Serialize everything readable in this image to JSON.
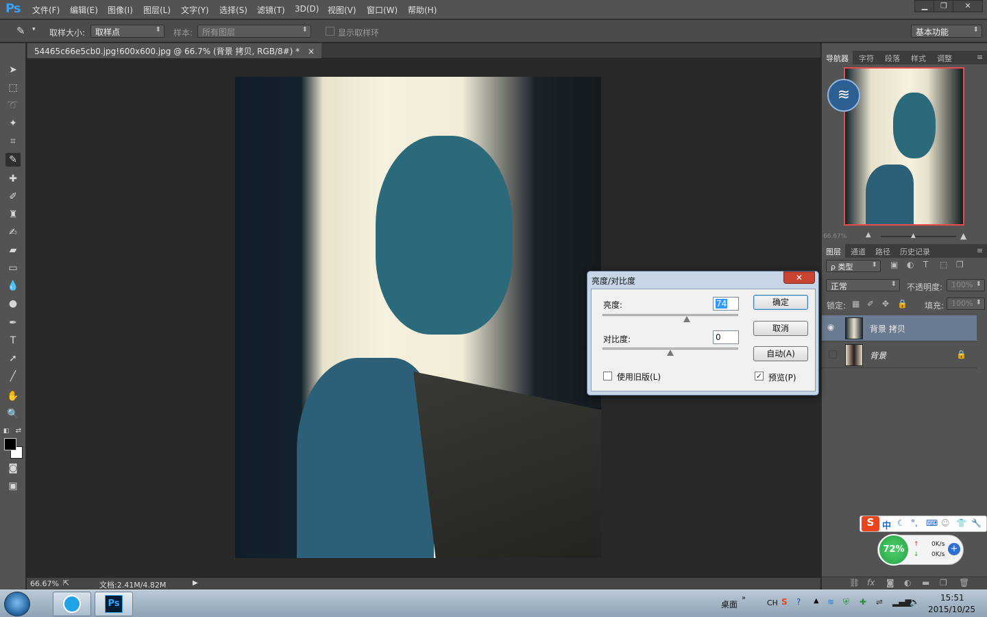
{
  "app": {
    "logo": "Ps"
  },
  "menu": [
    "文件(F)",
    "编辑(E)",
    "图像(I)",
    "图层(L)",
    "文字(Y)",
    "选择(S)",
    "滤镜(T)",
    "3D(D)",
    "视图(V)",
    "窗口(W)",
    "帮助(H)"
  ],
  "window_controls": {
    "minimize": "▁",
    "restore": "❐",
    "close": "✕"
  },
  "options": {
    "sample_size_label": "取样大小:",
    "sample_size_value": "取样点",
    "sample_label": "样本:",
    "sample_value": "所有图层",
    "show_ring_label": "显示取样环",
    "workspace": "基本功能"
  },
  "document": {
    "tab_title": "54465c66e5cb0.jpg!600x600.jpg @ 66.7% (背景 拷贝, RGB/8#) *",
    "tab_close": "×"
  },
  "status": {
    "zoom": "66.67%",
    "doc_size": "文档:2.41M/4.82M"
  },
  "panels": {
    "top_tabs": [
      "导航器",
      "字符",
      "段落",
      "样式",
      "调整"
    ],
    "nav_zoom": "66.67%",
    "layer_tabs": [
      "图层",
      "通道",
      "路径",
      "历史记录"
    ],
    "filter_kind": "ρ 类型",
    "blend_mode": "正常",
    "opacity_label": "不透明度:",
    "opacity_value": "100%",
    "lock_label": "锁定:",
    "fill_label": "填充:",
    "fill_value": "100%",
    "layers": [
      {
        "name": "背景 拷贝",
        "visible": true,
        "selected": true
      },
      {
        "name": "背景",
        "visible": false,
        "locked": true
      }
    ]
  },
  "dialog": {
    "title": "亮度/对比度",
    "brightness_label": "亮度:",
    "brightness_value": "74",
    "contrast_label": "对比度:",
    "contrast_value": "0",
    "ok": "确定",
    "cancel": "取消",
    "auto": "自动(A)",
    "legacy_label": "使用旧版(L)",
    "legacy_checked": false,
    "preview_label": "预览(P)",
    "preview_checked": true,
    "brightness_level": 0.62,
    "contrast_level": 0.5
  },
  "overlay": {
    "ime_mode": "中",
    "net_percent": "72%",
    "up_speed": "0K/s",
    "down_speed": "0K/s"
  },
  "taskbar": {
    "desktop": "桌面",
    "lang": "CH",
    "time": "15:51",
    "date": "2015/10/25"
  }
}
